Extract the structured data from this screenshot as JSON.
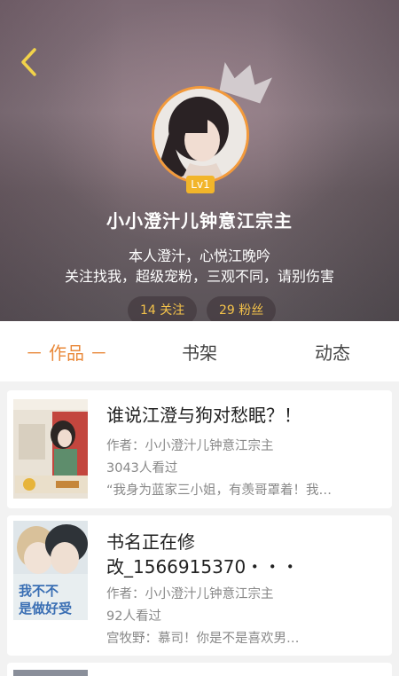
{
  "profile": {
    "level": "Lv1",
    "nickname": "小小澄汁儿钟意江宗主",
    "bio_line1": "本人澄汁，心悦江晚吟",
    "bio_line2": "关注找我，超级宠粉，三观不同，请别伤害",
    "following": "14 关注",
    "fans": "29 粉丝"
  },
  "tabs": [
    {
      "label": "－ 作品 －",
      "active": true
    },
    {
      "label": "书架",
      "active": false
    },
    {
      "label": "动态",
      "active": false
    }
  ],
  "books": [
    {
      "title": "谁说江澄与狗对愁眠？！",
      "author": "作者：小小澄汁儿钟意江宗主",
      "views": "3043人看过",
      "excerpt": "“我身为蓝家三小姐，有羡哥罩着！我…"
    },
    {
      "title_line1": "书名正在修",
      "title_line2": "改_1566915370・・・",
      "author": "作者：小小澄汁儿钟意江宗主",
      "views": "92人看过",
      "excerpt": "宫牧野：慕司！你是不是喜欢男…",
      "cover_text": "我不不是做好受"
    }
  ],
  "colors": {
    "accent": "#e9893a",
    "level_badge": "#f2b52a",
    "avatar_ring": "#f39a3b",
    "stat_text": "#f4c24a"
  },
  "icons": [
    "back-arrow-icon",
    "crown-icon"
  ]
}
